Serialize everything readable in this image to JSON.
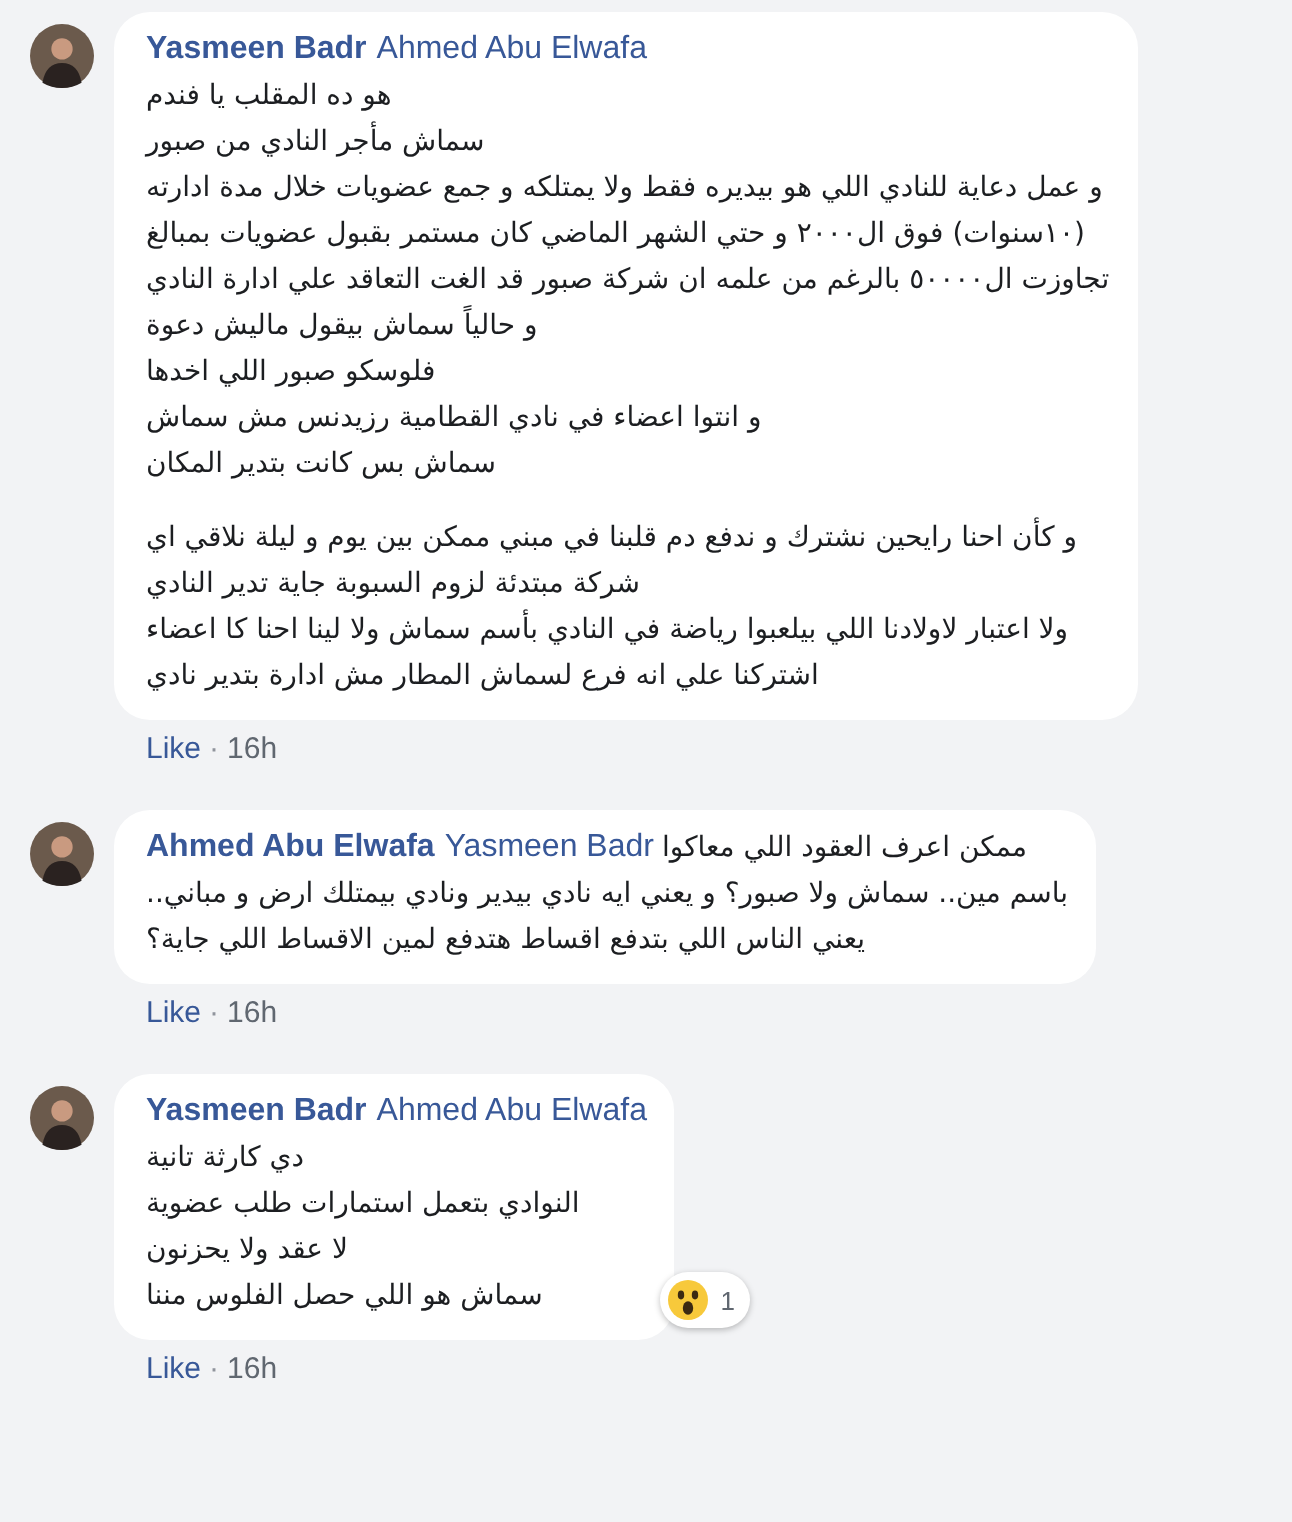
{
  "comments": [
    {
      "author": "Yasmeen Badr",
      "mention": "Ahmed Abu Elwafa",
      "paragraphs": [
        [
          "هو ده المقلب يا فندم",
          "سماش مأجر النادي من صبور",
          "و عمل دعاية للنادي اللي هو بيديره فقط ولا يمتلكه و جمع عضويات خلال مدة ادارته",
          "(١٠سنوات) فوق ال٢٠٠٠ و حتي الشهر الماضي كان مستمر بقبول عضويات بمبالغ",
          "تجاوزت ال٥٠٠٠٠ بالرغم من علمه ان شركة صبور قد الغت التعاقد علي ادارة النادي",
          "و حالياً سماش بيقول ماليش دعوة",
          "فلوسكو صبور اللي اخدها",
          "و انتوا اعضاء في نادي القطامية رزيدنس مش سماش",
          "سماش بس كانت بتدير المكان"
        ],
        [
          "و كأن احنا رايحين نشترك و ندفع دم قلبنا في مبني ممكن بين يوم و ليلة نلاقي اي",
          "شركة مبتدئة لزوم السبوبة جاية تدير النادي",
          "ولا اعتبار لاولادنا اللي بيلعبوا رياضة في النادي بأسم سماش ولا لينا احنا كا اعضاء",
          "اشتركنا علي انه فرع لسماش المطار مش ادارة بتدير نادي"
        ]
      ],
      "like": "Like",
      "separator": "·",
      "time": "16h"
    },
    {
      "author": "Ahmed Abu Elwafa",
      "mention": "Yasmeen Badr",
      "paragraphs": [
        [
          "ممكن اعرف العقود اللي معاكوا",
          "باسم مين.. سماش ولا صبور؟ و يعني ايه نادي بيدير ونادي بيمتلك ارض و مباني..",
          "يعني الناس اللي بتدفع اقساط هتدفع لمين الاقساط اللي جاية؟"
        ]
      ],
      "like": "Like",
      "separator": "·",
      "time": "16h"
    },
    {
      "author": "Yasmeen Badr",
      "mention": "Ahmed Abu Elwafa",
      "paragraphs": [
        [
          "دي كارثة تانية",
          "النوادي بتعمل استمارات طلب عضوية",
          "لا عقد ولا يحزنون",
          "سماش هو اللي حصل الفلوس مننا"
        ]
      ],
      "reaction": {
        "kind": "wow",
        "count": "1"
      },
      "like": "Like",
      "separator": "·",
      "time": "16h"
    }
  ]
}
